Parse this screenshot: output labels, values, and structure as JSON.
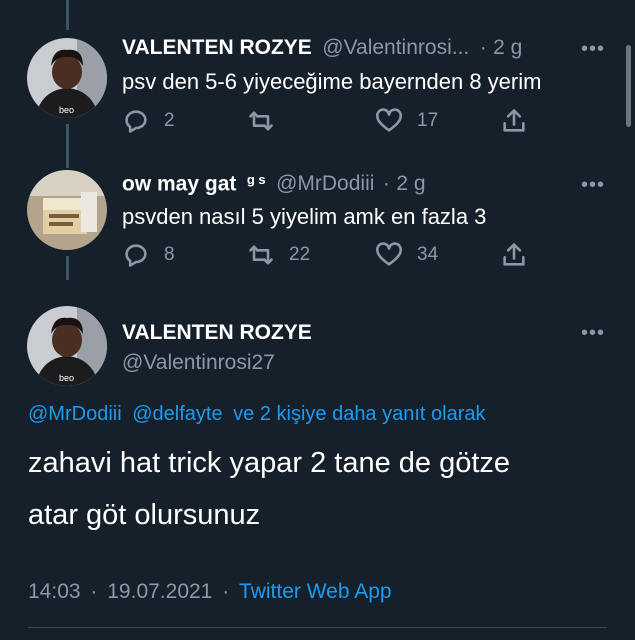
{
  "tweet1": {
    "name": "VALENTEN ROZYE",
    "handle": "@Valentinrosi...",
    "sep": "·",
    "time": "2 g",
    "text": "psv den 5-6 yiyeceğime bayernden 8 yerim",
    "replies": "2",
    "retweets": "",
    "likes": "17",
    "more": "•••"
  },
  "tweet2": {
    "name": "ow may gat",
    "badge": "g s",
    "handle": "@MrDodiii",
    "sep": "·",
    "time": "2 g",
    "text": "psvden nasıl 5 yiyelim amk en fazla 3",
    "replies": "8",
    "retweets": "22",
    "likes": "34",
    "more": "•••"
  },
  "main_tweet": {
    "name": "VALENTEN ROZYE",
    "handle": "@Valentinrosi27",
    "more": "•••",
    "reply_user1": "@MrDodiii",
    "reply_user2": "@delfayte",
    "reply_suffix": "ve 2 kişiye daha yanıt olarak",
    "text_line1": "zahavi hat trick yapar 2 tane de götze",
    "text_line2": "atar göt olursunuz",
    "time": "14:03",
    "sep1": "·",
    "date": "19.07.2021",
    "sep2": "·",
    "source": "Twitter Web App"
  },
  "colors": {
    "background": "#15202b",
    "secondary_text": "#8b98a5",
    "link": "#1d9bf0"
  }
}
